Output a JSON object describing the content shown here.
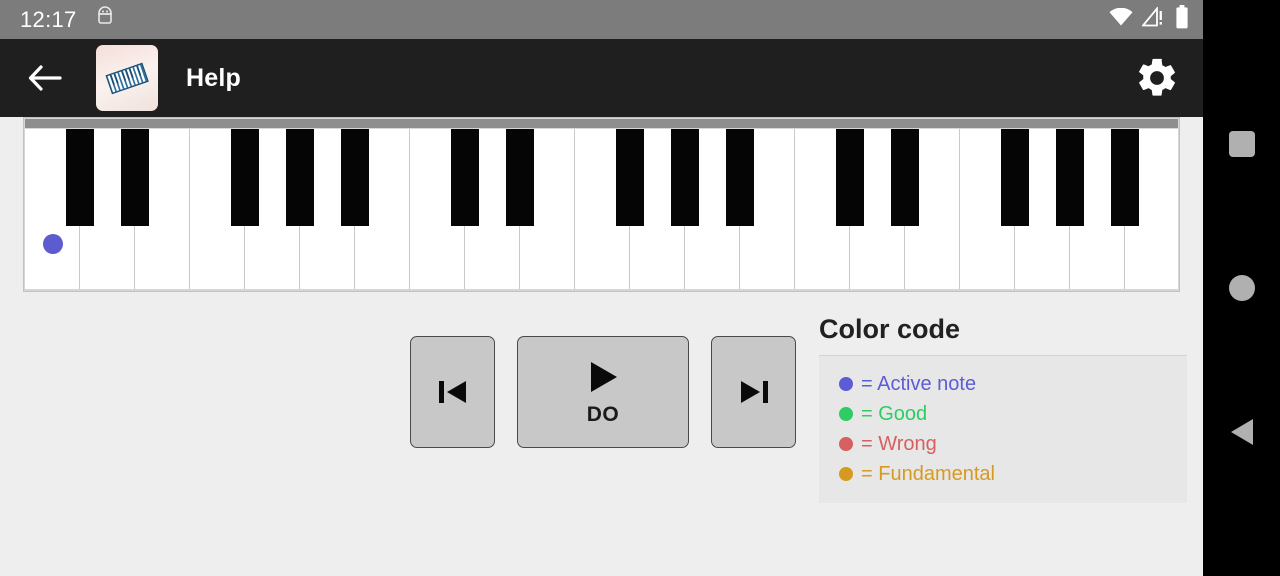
{
  "status_bar": {
    "clock": "12:17",
    "left_icons": [
      "android-debug-icon"
    ],
    "right_icons": [
      "wifi-icon",
      "cellular-signal-warning-icon",
      "battery-icon"
    ],
    "background": "#7c7c7c"
  },
  "app_bar": {
    "back_icon": "back-arrow-icon",
    "app_icon": "piano-app-icon",
    "title": "Help",
    "settings_icon": "gear-icon",
    "background": "#1f1f1f"
  },
  "keyboard": {
    "white_key_count": 21,
    "white_key_width": 55,
    "black_key_width": 28,
    "octave_pattern": [
      "C",
      "D",
      "E",
      "F",
      "G",
      "A",
      "B"
    ],
    "black_offsets_in_octave": [
      0,
      1,
      3,
      4,
      5
    ],
    "active_note": {
      "white_key_index": 0,
      "color": "#5c5cd0",
      "label": "active-note-marker"
    }
  },
  "transport": {
    "prev_label": "previous-track-icon",
    "play_icon": "play-icon",
    "play_label": "DO",
    "next_label": "next-track-icon"
  },
  "legend": {
    "title": "Color code",
    "items": [
      {
        "color": "#5c5cd6",
        "text": "= Active note"
      },
      {
        "color": "#2fcb63",
        "text": "= Good"
      },
      {
        "color": "#d65f5f",
        "text": "= Wrong"
      },
      {
        "color": "#d69a1e",
        "text": "= Fundamental"
      }
    ]
  },
  "nav_bar": {
    "recents_label": "recents-square-icon",
    "home_label": "home-circle-icon",
    "back_label": "back-triangle-icon",
    "background": "#000000"
  }
}
